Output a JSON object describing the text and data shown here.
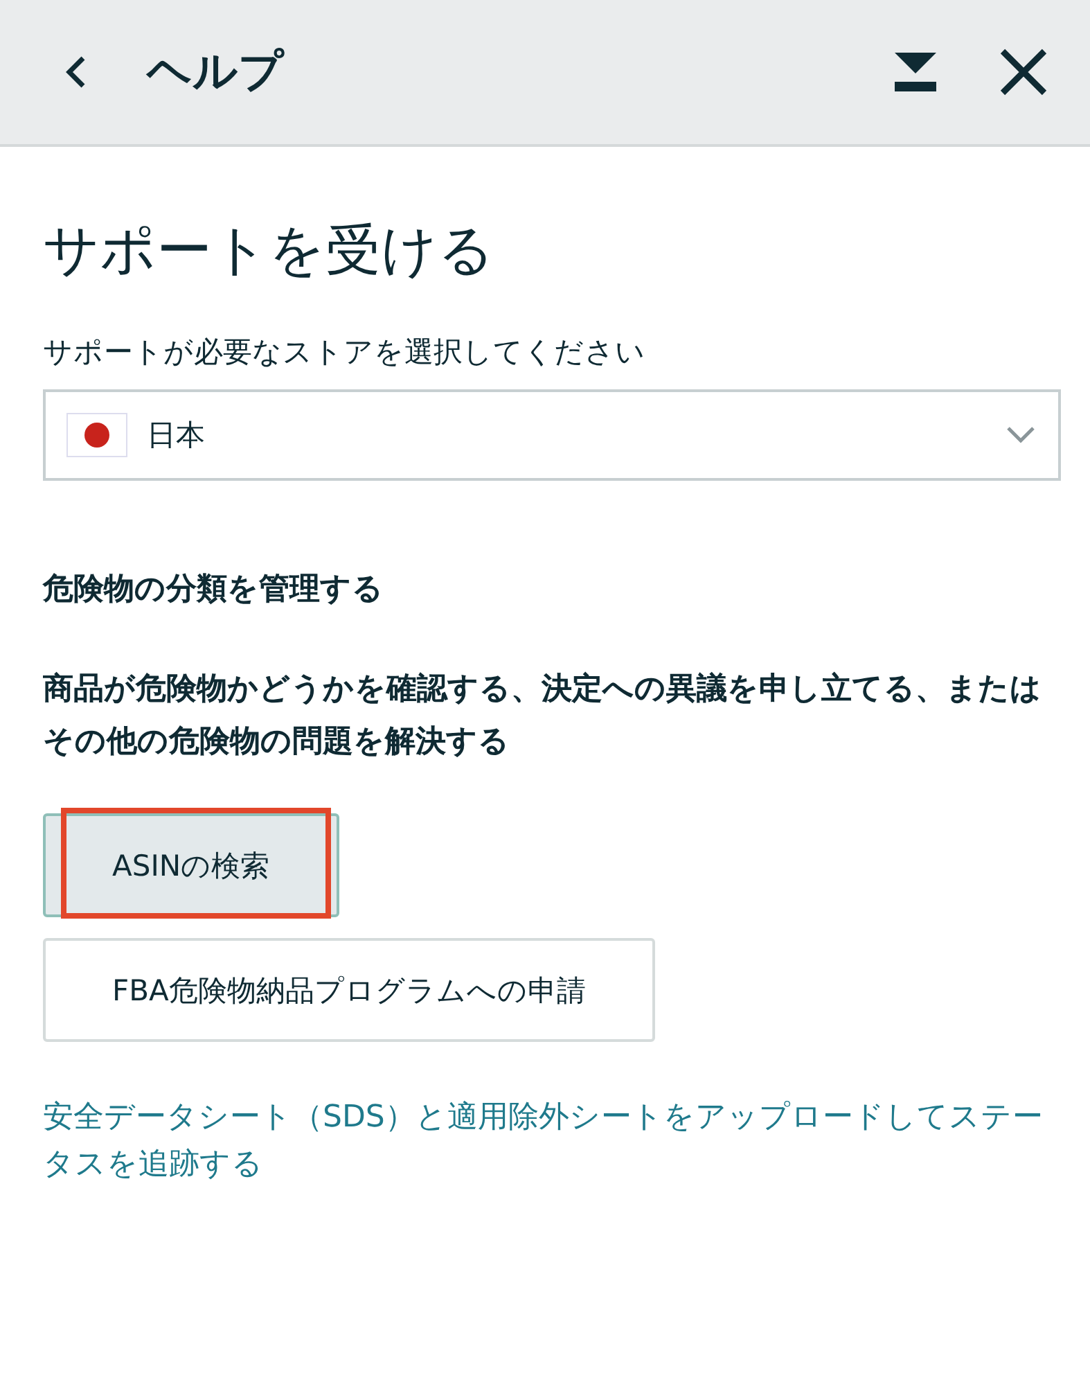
{
  "header": {
    "title": "ヘルプ"
  },
  "page_title": "サポートを受ける",
  "store_select": {
    "label": "サポートが必要なストアを選択してください",
    "value": "日本"
  },
  "section": {
    "heading": "危険物の分類を管理する",
    "description": "商品が危険物かどうかを確認する、決定への異議を申し立てる、またはその他の危険物の問題を解決する"
  },
  "buttons": [
    {
      "label": "ASINの検索",
      "selected": true,
      "highlighted": true
    },
    {
      "label": "FBA危険物納品プログラムへの申請",
      "selected": false,
      "highlighted": false
    }
  ],
  "link": "安全データシート（SDS）と適用除外シートをアップロードしてステータスを追跡する"
}
